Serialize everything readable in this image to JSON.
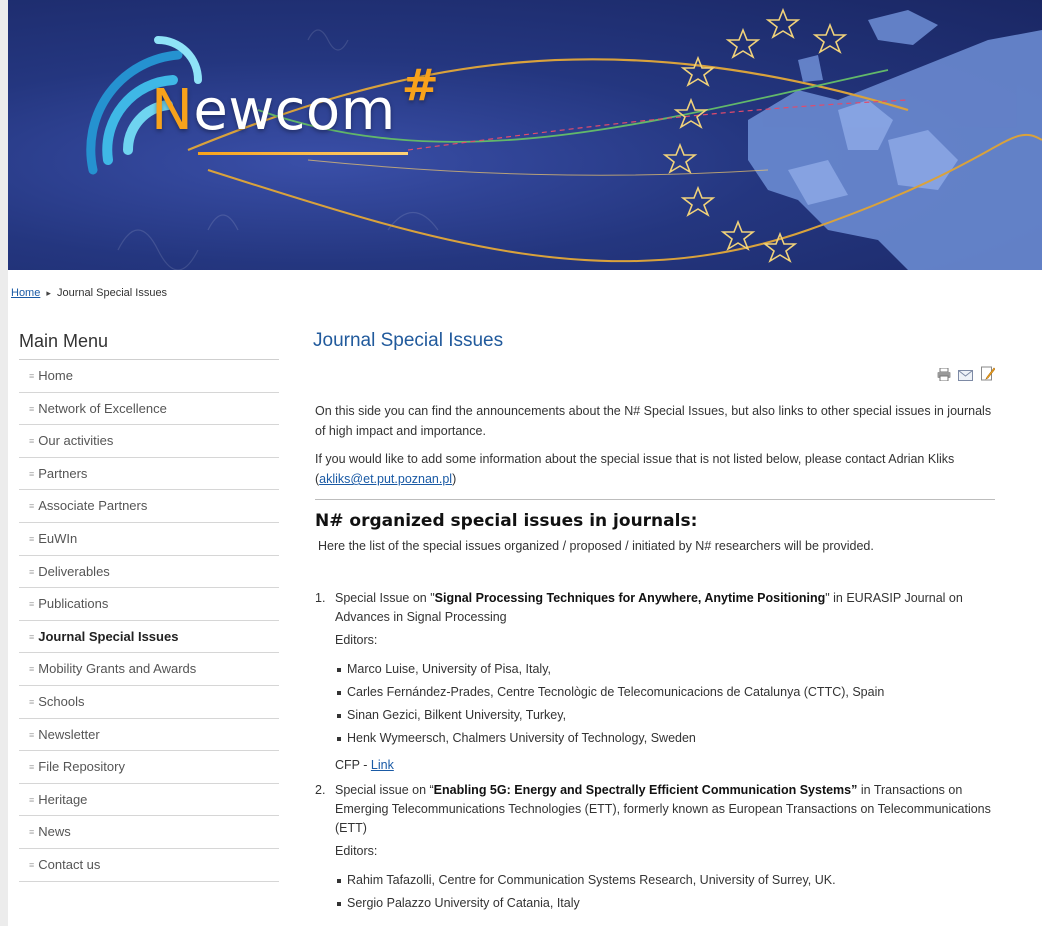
{
  "banner": {
    "logo_n": "N",
    "logo_rest": "ewcom",
    "logo_mark": "#"
  },
  "breadcrumb": {
    "home": "Home",
    "separator": "▸",
    "current": "Journal Special Issues"
  },
  "sidebar": {
    "title": "Main Menu",
    "items": [
      {
        "label": "Home",
        "active": false
      },
      {
        "label": "Network of Excellence",
        "active": false
      },
      {
        "label": "Our activities",
        "active": false
      },
      {
        "label": "Partners",
        "active": false
      },
      {
        "label": "Associate Partners",
        "active": false
      },
      {
        "label": "EuWIn",
        "active": false
      },
      {
        "label": "Deliverables",
        "active": false
      },
      {
        "label": "Publications",
        "active": false
      },
      {
        "label": "Journal Special Issues",
        "active": true
      },
      {
        "label": "Mobility Grants and Awards",
        "active": false
      },
      {
        "label": "Schools",
        "active": false
      },
      {
        "label": "Newsletter",
        "active": false
      },
      {
        "label": "File Repository",
        "active": false
      },
      {
        "label": "Heritage",
        "active": false
      },
      {
        "label": "News",
        "active": false
      },
      {
        "label": "Contact us",
        "active": false
      }
    ]
  },
  "content": {
    "title": "Journal Special Issues",
    "tools": {
      "print_icon": "printer-icon",
      "email_icon": "email-icon",
      "edit_icon": "edit-icon"
    },
    "intro_1": "On this side you can find the announcements about the N# Special Issues, but also links to other special issues in journals of high impact and importance.",
    "intro_2_prefix": "If you would like to add some information about the special issue that is not listed below, please contact Adrian Kliks (",
    "intro_2_email": "akliks@et.put.poznan.pl",
    "intro_2_suffix": ")",
    "section_title": "N# organized special issues in journals:",
    "section_sub": "Here the list of the special issues organized / proposed / initiated by N# researchers will be provided.",
    "issues": [
      {
        "num": "1.",
        "prefix": "Special Issue on \"",
        "bold": "Signal Processing Techniques for Anywhere, Anytime Positioning",
        "suffix": "\" in EURASIP Journal on Advances in Signal Processing",
        "editors_label": "Editors:",
        "editors": [
          "Marco Luise, University of Pisa, Italy,",
          "Carles Fernández-Prades, Centre Tecnològic de Telecomunicacions de Catalunya (CTTC), Spain",
          "Sinan Gezici, Bilkent University, Turkey,",
          "Henk Wymeersch, Chalmers University of Technology, Sweden"
        ],
        "cfp_prefix": "CFP - ",
        "cfp_link": "Link"
      },
      {
        "num": "2.",
        "prefix": "Special issue on “",
        "bold": "Enabling 5G: Energy and Spectrally Efficient Communication Systems”",
        "suffix": " in Transactions on Emerging Telecommunications Technologies (ETT), formerly known as European Transactions on Telecommunications (ETT)",
        "editors_label": "Editors:",
        "editors": [
          "Rahim Tafazolli,  Centre for Communication Systems Research, University of Surrey, UK.",
          "Sergio Palazzo University of Catania, Italy"
        ]
      }
    ]
  },
  "colors": {
    "banner_dark": "#1a2764",
    "logo_orange": "#f7a21b",
    "link_blue": "#1a5aa5",
    "title_blue": "#215a9c"
  }
}
